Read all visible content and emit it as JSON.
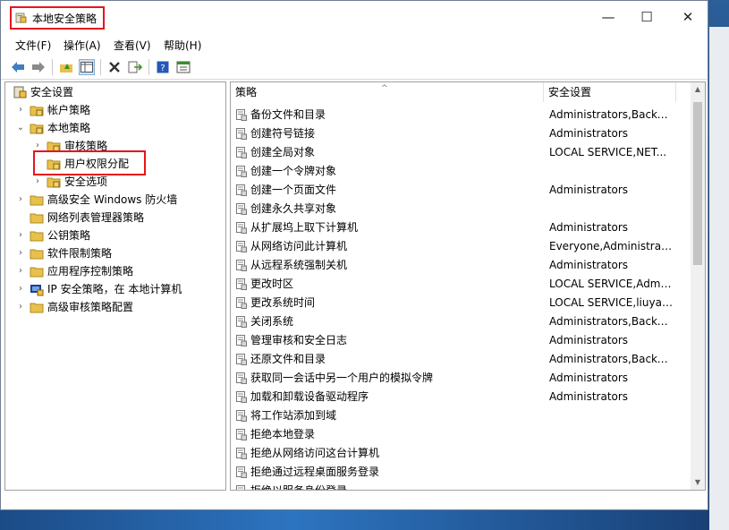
{
  "window": {
    "title": "本地安全策略"
  },
  "controls": {
    "minimize": "—",
    "maximize": "☐",
    "close": "✕"
  },
  "menu": [
    "文件(F)",
    "操作(A)",
    "查看(V)",
    "帮助(H)"
  ],
  "toolbar": {
    "icons": [
      "back-icon",
      "forward-icon",
      "up-folder-icon",
      "show-tree-icon",
      "delete-icon",
      "export-icon",
      "help-icon",
      "properties-icon"
    ]
  },
  "tree": [
    {
      "label": "安全设置",
      "level": 0,
      "expanded": "open",
      "icon": "security-settings-icon"
    },
    {
      "label": "帐户策略",
      "level": 1,
      "expanded": "closed",
      "icon": "folder-lock-icon"
    },
    {
      "label": "本地策略",
      "level": 1,
      "expanded": "open",
      "icon": "folder-lock-icon"
    },
    {
      "label": "审核策略",
      "level": 2,
      "expanded": "closed",
      "icon": "folder-lock-icon"
    },
    {
      "label": "用户权限分配",
      "level": 2,
      "expanded": "none",
      "icon": "folder-lock-icon",
      "selected": true
    },
    {
      "label": "安全选项",
      "level": 2,
      "expanded": "closed",
      "icon": "folder-lock-icon"
    },
    {
      "label": "高级安全 Windows 防火墙",
      "level": 1,
      "expanded": "closed",
      "icon": "folder-icon"
    },
    {
      "label": "网络列表管理器策略",
      "level": 1,
      "expanded": "none",
      "icon": "folder-icon"
    },
    {
      "label": "公钥策略",
      "level": 1,
      "expanded": "closed",
      "icon": "folder-icon"
    },
    {
      "label": "软件限制策略",
      "level": 1,
      "expanded": "closed",
      "icon": "folder-icon"
    },
    {
      "label": "应用程序控制策略",
      "level": 1,
      "expanded": "closed",
      "icon": "folder-icon"
    },
    {
      "label": "IP 安全策略，在 本地计算机",
      "level": 1,
      "expanded": "closed",
      "icon": "ip-security-icon"
    },
    {
      "label": "高级审核策略配置",
      "level": 1,
      "expanded": "closed",
      "icon": "folder-icon"
    }
  ],
  "list": {
    "columns": [
      "策略",
      "安全设置"
    ],
    "sort_glyph": "^",
    "rows": [
      {
        "policy": "备份文件和目录",
        "setting": "Administrators,Backu..."
      },
      {
        "policy": "创建符号链接",
        "setting": "Administrators"
      },
      {
        "policy": "创建全局对象",
        "setting": "LOCAL SERVICE,NET..."
      },
      {
        "policy": "创建一个令牌对象",
        "setting": ""
      },
      {
        "policy": "创建一个页面文件",
        "setting": "Administrators"
      },
      {
        "policy": "创建永久共享对象",
        "setting": ""
      },
      {
        "policy": "从扩展坞上取下计算机",
        "setting": "Administrators"
      },
      {
        "policy": "从网络访问此计算机",
        "setting": "Everyone,Administrat..."
      },
      {
        "policy": "从远程系统强制关机",
        "setting": "Administrators"
      },
      {
        "policy": "更改时区",
        "setting": "LOCAL SERVICE,Admi..."
      },
      {
        "policy": "更改系统时间",
        "setting": "LOCAL SERVICE,liuyan..."
      },
      {
        "policy": "关闭系统",
        "setting": "Administrators,Backu..."
      },
      {
        "policy": "管理审核和安全日志",
        "setting": "Administrators"
      },
      {
        "policy": "还原文件和目录",
        "setting": "Administrators,Backu..."
      },
      {
        "policy": "获取同一会话中另一个用户的模拟令牌",
        "setting": "Administrators"
      },
      {
        "policy": "加载和卸载设备驱动程序",
        "setting": "Administrators"
      },
      {
        "policy": "将工作站添加到域",
        "setting": ""
      },
      {
        "policy": "拒绝本地登录",
        "setting": ""
      },
      {
        "policy": "拒绝从网络访问这台计算机",
        "setting": ""
      },
      {
        "policy": "拒绝通过远程桌面服务登录",
        "setting": ""
      },
      {
        "policy": "拒绝以服务身份登录",
        "setting": ""
      }
    ]
  },
  "scroll": {
    "up": "▲",
    "down": "▼"
  },
  "colors": {
    "highlight_border": "#e8141c",
    "accent": "#2d74c0"
  }
}
